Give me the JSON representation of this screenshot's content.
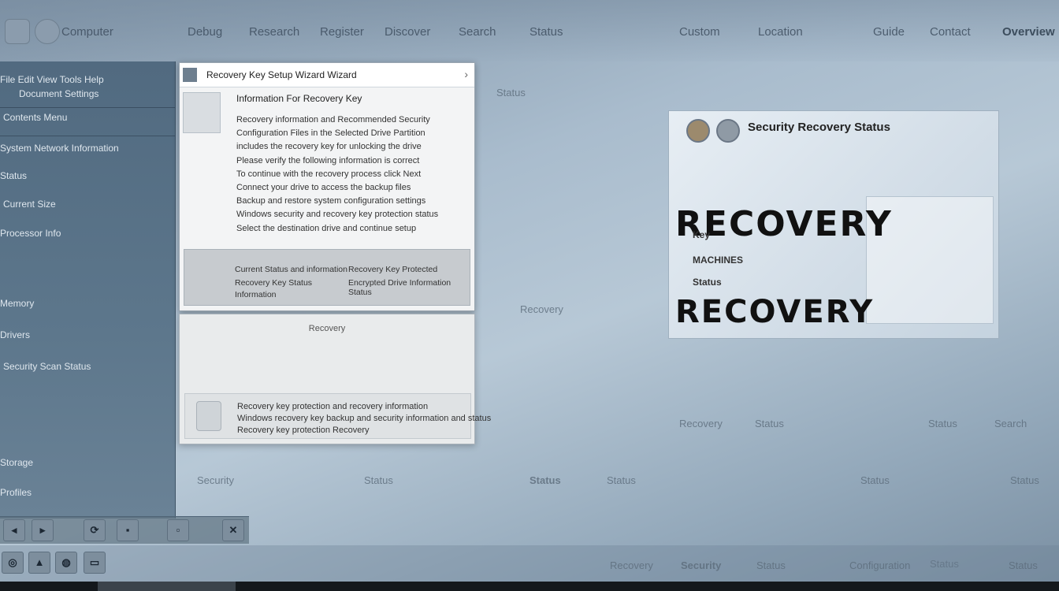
{
  "top_bar": {
    "items": [
      "Computer",
      "Debug",
      "Research",
      "Register",
      "Discover",
      "Search",
      "Status",
      "Custom",
      "Location",
      "Guide",
      "Contact",
      "Overview"
    ]
  },
  "sidebar": {
    "header_line1": "File  Edit  View  Tools  Help",
    "header_line2": "Document  Settings",
    "items": [
      "Contents  Menu",
      "System  Network  Information",
      "Status",
      "Current  Size",
      "Processor  Info",
      "Memory",
      "Drivers",
      "Security  Scan  Status",
      "Storage",
      "Profiles"
    ]
  },
  "dialog": {
    "title": "Recovery Key  Setup  Wizard  Wizard",
    "subtitle": "Information  For  Recovery  Key",
    "body_lines": [
      "Recovery information  and  Recommended  Security",
      "Configuration  Files  in the  Selected  Drive  Partition",
      "includes the  recovery  key  for  unlocking  the  drive",
      "Please verify  the  following  information  is  correct",
      "To  continue  with  the  recovery  process  click  Next",
      "Connect  your  drive  to  access  the  backup  files",
      "Backup and  restore  system  configuration  settings",
      "Windows  security  and  recovery  key  protection  status",
      "Select  the  destination  drive  and  continue  setup"
    ],
    "footer": {
      "left1": "Current  Status  and  information",
      "left2": "Recovery  Key  Status",
      "left3": "Information",
      "right1": "Recovery  Key  Protected",
      "right2": "Encrypted  Drive  Information  Status"
    }
  },
  "dialog2": {
    "title": "Recovery",
    "lines": [
      "Recovery key protection and recovery information",
      "Windows recovery key backup and security information and status",
      "Recovery key protection Recovery"
    ]
  },
  "card": {
    "title": "Security  Recovery  Status",
    "big1": "RECOVERY",
    "big2": "RECOVERY",
    "small1": "Key",
    "small2": "MACHINES",
    "small3": "Status"
  },
  "bottom_toolbar": {
    "buttons": [
      "Back",
      "Next",
      "Refresh",
      "Save",
      "Print",
      "Close"
    ]
  },
  "workspace_labels": [
    "Status",
    "Recovery",
    "Recovery",
    "Status",
    "Status",
    "Search",
    "Security",
    "Status",
    "Status",
    "Status",
    "Status",
    "Status",
    "Status"
  ],
  "taskbar": {
    "labels": [
      "Recovery",
      "Security",
      "Status",
      "Configuration",
      "Status"
    ]
  }
}
